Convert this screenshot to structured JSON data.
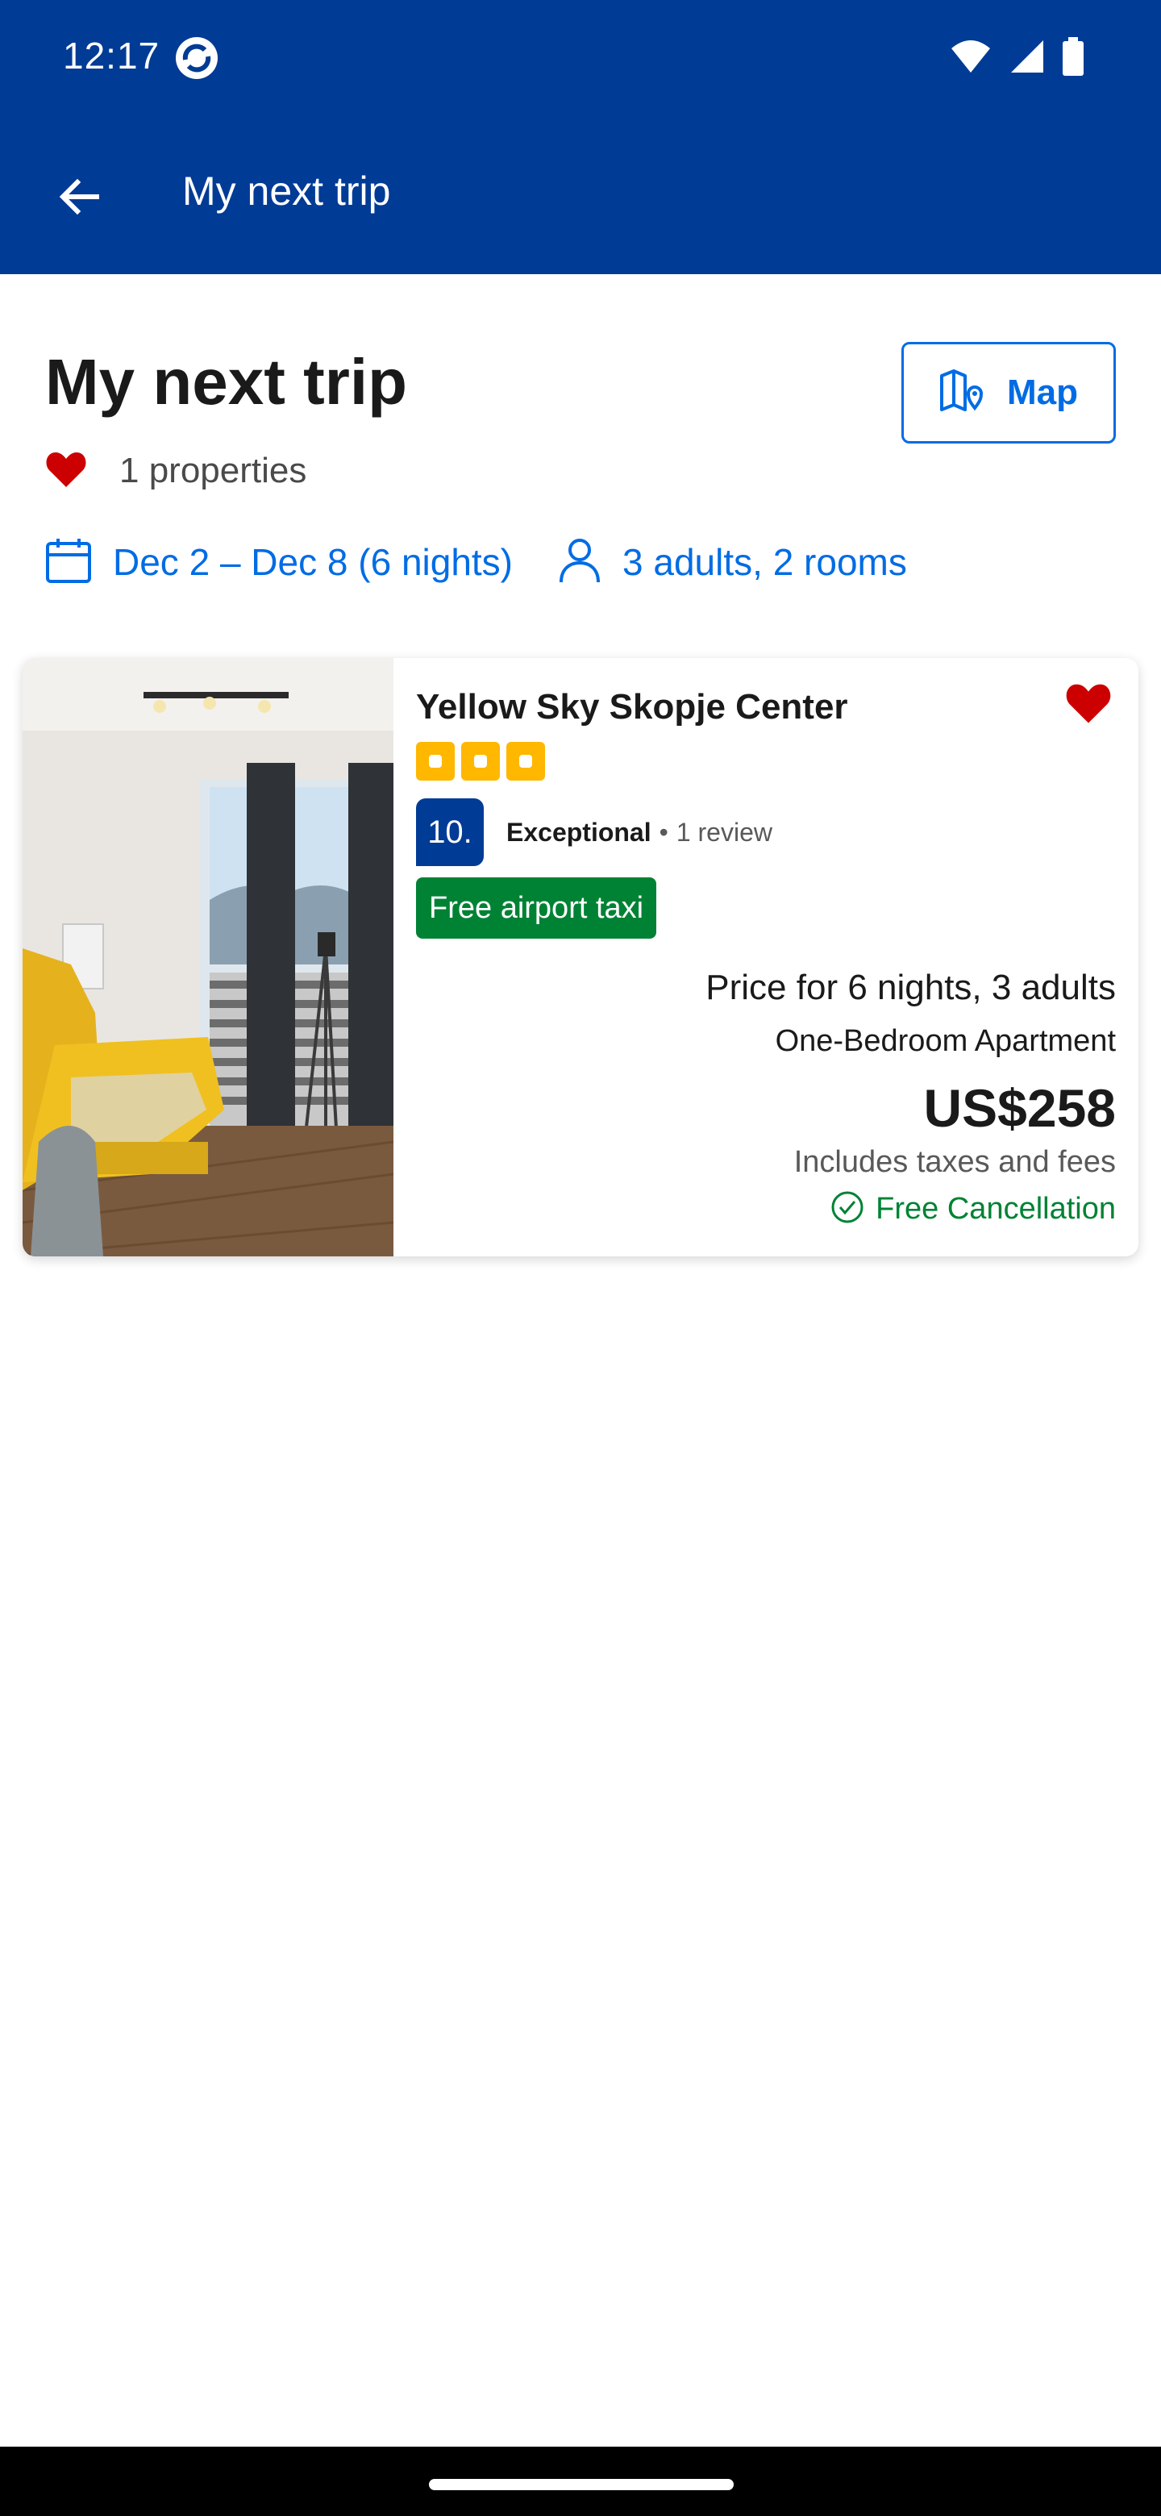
{
  "status_bar": {
    "time": "12:17"
  },
  "app_bar": {
    "title": "My next trip"
  },
  "header": {
    "title": "My next trip",
    "map_label": "Map",
    "saved_count": "1 properties"
  },
  "filters": {
    "dates": "Dec 2 – Dec 8 (6 nights)",
    "guests": "3 adults, 2 rooms"
  },
  "property": {
    "name": "Yellow Sky Skopje Center",
    "stars": 3,
    "score": "10.",
    "rating_word": "Exceptional",
    "separator": "•",
    "review_count": "1 review",
    "badge": "Free airport taxi",
    "price_for": "Price for 6 nights, 3 adults",
    "room_type": "One-Bedroom Apartment",
    "price": "US$258",
    "taxes": "Includes taxes and fees",
    "cancellation": "Free Cancellation"
  },
  "colors": {
    "brand": "#003b95",
    "link": "#006ce4",
    "favorite": "#cc0000",
    "stars": "#ffb700",
    "success": "#008234"
  },
  "icons": [
    "wifi-icon",
    "signal-icon",
    "battery-icon",
    "back-arrow-icon",
    "map-icon",
    "heart-icon",
    "calendar-icon",
    "person-icon",
    "check-circle-icon"
  ]
}
